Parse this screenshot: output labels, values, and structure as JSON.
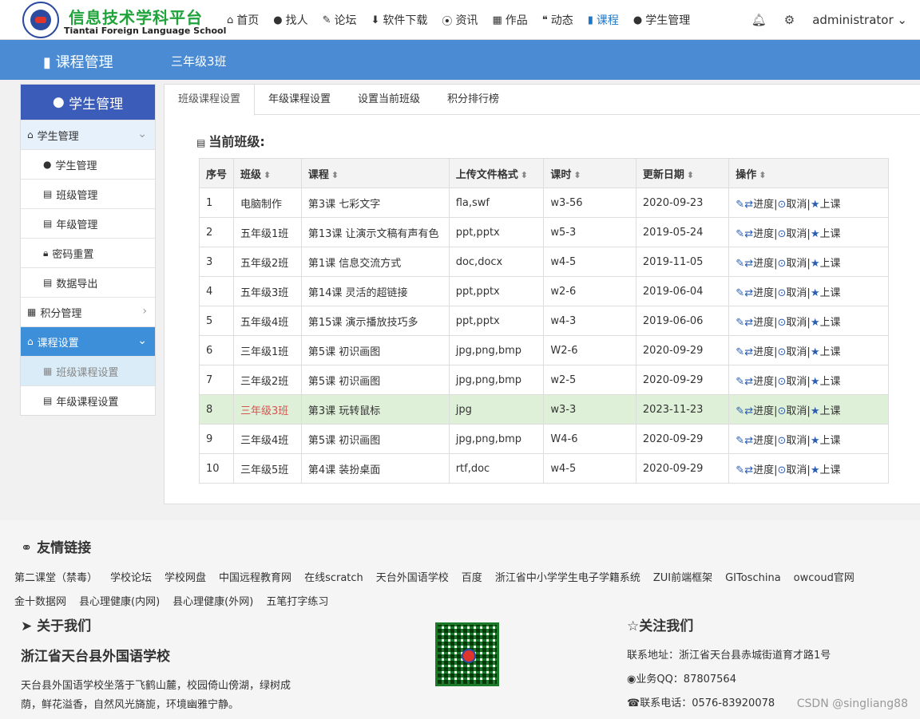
{
  "brand": {
    "title": "信息技术学科平台",
    "subtitle": "Tiantai Foreign Language School"
  },
  "nav": [
    {
      "icon": "home-icon",
      "glyph": "⌂",
      "label": "首页"
    },
    {
      "icon": "user-icon",
      "glyph": "●",
      "label": "找人"
    },
    {
      "icon": "comments-icon",
      "glyph": "✎",
      "label": "论坛"
    },
    {
      "icon": "download-icon",
      "glyph": "⬇",
      "label": "软件下载"
    },
    {
      "icon": "rss-icon",
      "glyph": "⦿",
      "label": "资讯"
    },
    {
      "icon": "grid-icon",
      "glyph": "▦",
      "label": "作品"
    },
    {
      "icon": "quote-icon",
      "glyph": "❝",
      "label": "动态"
    },
    {
      "icon": "book-icon",
      "glyph": "▮",
      "label": "课程",
      "active": true
    },
    {
      "icon": "user-icon",
      "glyph": "●",
      "label": "学生管理"
    }
  ],
  "user": {
    "name": "administrator"
  },
  "band": {
    "title": "课程管理",
    "crumb": "三年级3班"
  },
  "sidebar": {
    "header": "学生管理",
    "items": [
      {
        "type": "group",
        "label": "学生管理",
        "icon": "home-icon",
        "state": "open"
      },
      {
        "type": "sub",
        "label": "学生管理",
        "icon": "user-icon"
      },
      {
        "type": "sub",
        "label": "班级管理",
        "icon": "list-icon"
      },
      {
        "type": "sub",
        "label": "年级管理",
        "icon": "list-icon"
      },
      {
        "type": "sub",
        "label": "密码重置",
        "icon": "lock-icon"
      },
      {
        "type": "sub",
        "label": "数据导出",
        "icon": "list-icon"
      },
      {
        "type": "group",
        "label": "积分管理",
        "icon": "grid-icon",
        "state": "closed"
      },
      {
        "type": "group",
        "label": "课程设置",
        "icon": "home-icon",
        "state": "active"
      },
      {
        "type": "sub",
        "label": "班级课程设置",
        "icon": "grid-icon",
        "selected": true
      },
      {
        "type": "sub",
        "label": "年级课程设置",
        "icon": "list-icon"
      }
    ]
  },
  "tabs": [
    "班级课程设置",
    "年级课程设置",
    "设置当前班级",
    "积分排行榜"
  ],
  "current_label": "当前班级:",
  "table": {
    "headers": [
      "序号",
      "班级",
      "课程",
      "上传文件格式",
      "课时",
      "更新日期",
      "操作"
    ],
    "rows": [
      [
        "1",
        "电脑制作",
        "第3课 七彩文字",
        "fla,swf",
        "w3-56",
        "2020-09-23"
      ],
      [
        "2",
        "五年级1班",
        "第13课 让演示文稿有声有色",
        "ppt,pptx",
        "w5-3",
        "2019-05-24"
      ],
      [
        "3",
        "五年级2班",
        "第1课 信息交流方式",
        "doc,docx",
        "w4-5",
        "2019-11-05"
      ],
      [
        "4",
        "五年级3班",
        "第14课 灵活的超链接",
        "ppt,pptx",
        "w2-6",
        "2019-06-04"
      ],
      [
        "5",
        "五年级4班",
        "第15课 演示播放技巧多",
        "ppt,pptx",
        "w4-3",
        "2019-06-06"
      ],
      [
        "6",
        "三年级1班",
        "第5课 初识画图",
        "jpg,png,bmp",
        "W2-6",
        "2020-09-29"
      ],
      [
        "7",
        "三年级2班",
        "第5课 初识画图",
        "jpg,png,bmp",
        "w2-5",
        "2020-09-29"
      ],
      [
        "8",
        "三年级3班",
        "第3课 玩转鼠标",
        "jpg",
        "w3-3",
        "2023-11-23"
      ],
      [
        "9",
        "三年级4班",
        "第5课 初识画图",
        "jpg,png,bmp",
        "W4-6",
        "2020-09-29"
      ],
      [
        "10",
        "三年级5班",
        "第4课 装扮桌面",
        "rtf,doc",
        "w4-5",
        "2020-09-29"
      ]
    ],
    "highlight_row": 7,
    "ops": {
      "progress": "进度",
      "cancel": "取消",
      "start": "上课"
    }
  },
  "footer": {
    "links_title": "友情链接",
    "links": [
      "第二课堂（禁毒）",
      "学校论坛",
      "学校网盘",
      "中国远程教育网",
      "在线scratch",
      "天台外国语学校",
      "百度",
      "浙江省中小学学生电子学籍系统",
      "ZUI前端框架",
      "GIToschina",
      "owcoud官网",
      "金十数据网",
      "县心理健康(内网)",
      "县心理健康(外网)",
      "五笔打字练习"
    ],
    "about_title": "关于我们",
    "school": "浙江省天台县外国语学校",
    "desc": "天台县外国语学校坐落于飞鹤山麓，校园倚山傍湖，绿树成荫，鲜花溢香，自然风光旖旎，环境幽雅宁静。",
    "follow_title": "关注我们",
    "address": "联系地址：浙江省天台县赤城街道育才路1号",
    "qq": "业务QQ：87807564",
    "tel": "联系电话：0576-83920078",
    "watermark": "CSDN @singliang88"
  },
  "colors": {
    "accent": "#4a8bd4",
    "sidebar_head": "#3b5cb8",
    "highlight": "#dff0d8",
    "brand_green": "#1fa33a"
  }
}
